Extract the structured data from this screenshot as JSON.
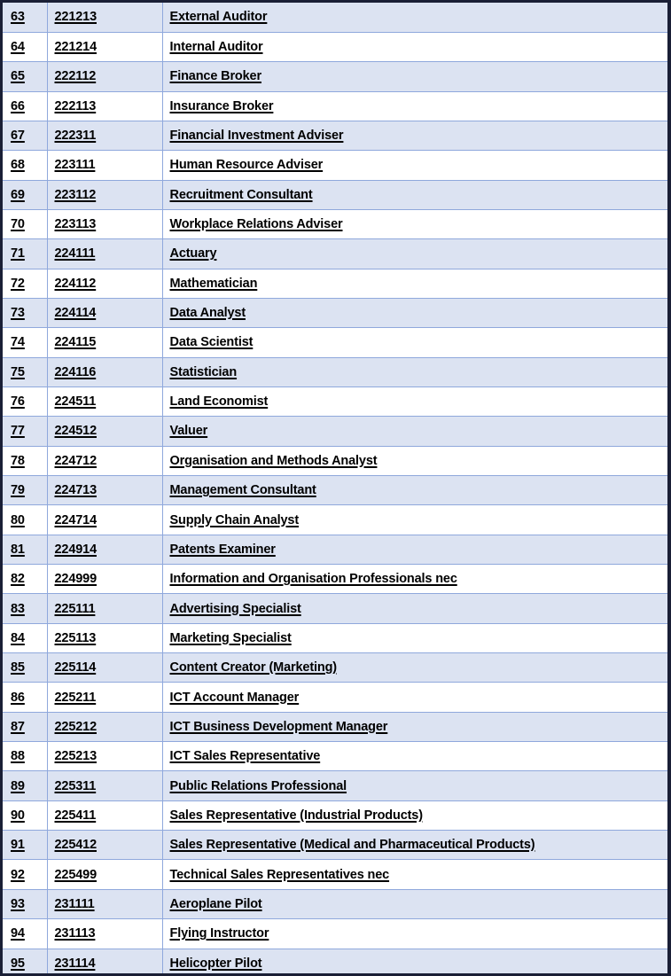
{
  "document": {
    "kind": "occupation-reference-table",
    "colors": {
      "frame_border": "#1a1f36",
      "grid_line": "#8fa8dc",
      "row_shaded_background": "#dce3f2",
      "row_plain_background": "#ffffff",
      "text": "#000000"
    },
    "columns": [
      {
        "key": "index",
        "label": ""
      },
      {
        "key": "code",
        "label": ""
      },
      {
        "key": "occupation",
        "label": ""
      }
    ]
  },
  "rows": [
    {
      "index": "63",
      "code": "221213",
      "occupation": "External Auditor"
    },
    {
      "index": "64",
      "code": "221214",
      "occupation": "Internal Auditor"
    },
    {
      "index": "65",
      "code": "222112",
      "occupation": "Finance Broker"
    },
    {
      "index": "66",
      "code": "222113",
      "occupation": "Insurance Broker"
    },
    {
      "index": "67",
      "code": "222311",
      "occupation": "Financial Investment Adviser"
    },
    {
      "index": "68",
      "code": "223111",
      "occupation": "Human Resource Adviser"
    },
    {
      "index": "69",
      "code": "223112",
      "occupation": "Recruitment Consultant"
    },
    {
      "index": "70",
      "code": "223113",
      "occupation": "Workplace Relations Adviser"
    },
    {
      "index": "71",
      "code": "224111",
      "occupation": "Actuary"
    },
    {
      "index": "72",
      "code": "224112",
      "occupation": "Mathematician"
    },
    {
      "index": "73",
      "code": "224114",
      "occupation": "Data Analyst"
    },
    {
      "index": "74",
      "code": "224115",
      "occupation": "Data Scientist"
    },
    {
      "index": "75",
      "code": "224116",
      "occupation": "Statistician"
    },
    {
      "index": "76",
      "code": "224511",
      "occupation": "Land Economist"
    },
    {
      "index": "77",
      "code": "224512",
      "occupation": "Valuer"
    },
    {
      "index": "78",
      "code": "224712",
      "occupation": "Organisation and Methods Analyst"
    },
    {
      "index": "79",
      "code": "224713",
      "occupation": "Management Consultant"
    },
    {
      "index": "80",
      "code": "224714",
      "occupation": "Supply Chain Analyst"
    },
    {
      "index": "81",
      "code": "224914",
      "occupation": "Patents Examiner"
    },
    {
      "index": "82",
      "code": "224999",
      "occupation": "Information and Organisation Professionals nec"
    },
    {
      "index": "83",
      "code": "225111",
      "occupation": "Advertising Specialist"
    },
    {
      "index": "84",
      "code": "225113",
      "occupation": "Marketing Specialist"
    },
    {
      "index": "85",
      "code": "225114",
      "occupation": "Content Creator (Marketing)"
    },
    {
      "index": "86",
      "code": "225211",
      "occupation": "ICT Account Manager"
    },
    {
      "index": "87",
      "code": "225212",
      "occupation": "ICT Business Development Manager"
    },
    {
      "index": "88",
      "code": "225213",
      "occupation": "ICT Sales Representative"
    },
    {
      "index": "89",
      "code": "225311",
      "occupation": "Public Relations Professional"
    },
    {
      "index": "90",
      "code": "225411",
      "occupation": "Sales Representative (Industrial Products)"
    },
    {
      "index": "91",
      "code": "225412",
      "occupation": "Sales Representative (Medical and Pharmaceutical Products)"
    },
    {
      "index": "92",
      "code": "225499",
      "occupation": "Technical Sales Representatives nec"
    },
    {
      "index": "93",
      "code": "231111",
      "occupation": "Aeroplane Pilot"
    },
    {
      "index": "94",
      "code": "231113",
      "occupation": "Flying Instructor"
    },
    {
      "index": "95",
      "code": "231114",
      "occupation": "Helicopter Pilot"
    }
  ]
}
